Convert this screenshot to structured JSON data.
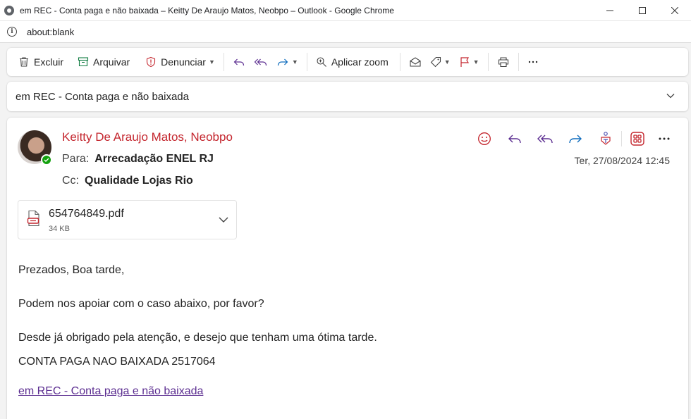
{
  "window": {
    "title": "em REC - Conta paga e não baixada – Keitty De Araujo Matos, Neobpo – Outlook - Google Chrome",
    "url": "about:blank"
  },
  "toolbar": {
    "delete_label": "Excluir",
    "archive_label": "Arquivar",
    "report_label": "Denunciar",
    "zoom_label": "Aplicar zoom"
  },
  "subject": "em REC - Conta paga e não baixada",
  "message": {
    "sender": "Keitty De Araujo Matos, Neobpo",
    "to_label": "Para:",
    "to_value": "Arrecadação ENEL RJ",
    "cc_label": "Cc:",
    "cc_value": "Qualidade Lojas Rio",
    "date": "Ter, 27/08/2024 12:45",
    "attachment": {
      "name": "654764849.pdf",
      "size": "34 KB"
    },
    "body": [
      "Prezados, Boa tarde,",
      "Podem nos apoiar com o caso abaixo, por favor?",
      "Desde já obrigado pela atenção, e desejo que tenham uma ótima tarde.",
      "CONTA PAGA NAO BAIXADA 2517064"
    ],
    "link_text": "em REC - Conta paga e não baixada"
  },
  "colors": {
    "sender": "#c4262e",
    "link": "#5c2e91",
    "accent": "#0f6cbd",
    "action_purple": "#5c2e91",
    "presence": "#13a10e"
  },
  "icons": [
    "app-icon",
    "minimize-icon",
    "maximize-icon",
    "close-icon",
    "info-icon",
    "trash-icon",
    "archive-icon",
    "shield-icon",
    "reply-icon",
    "reply-all-icon",
    "forward-icon",
    "zoom-icon",
    "envelope-icon",
    "tag-icon",
    "flag-icon",
    "print-icon",
    "more-icon",
    "chevron-down-icon",
    "emoji-icon",
    "teams-icon",
    "apps-icon",
    "pdf-icon"
  ]
}
